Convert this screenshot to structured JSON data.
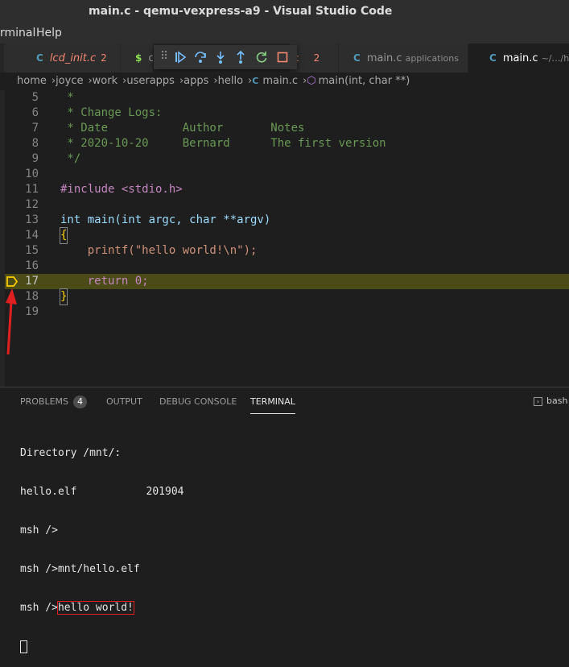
{
  "window": {
    "title": "main.c - qemu-vexpress-a9 - Visual Studio Code"
  },
  "menu": {
    "items": [
      "rminal",
      "Help"
    ]
  },
  "tabs": [
    {
      "icon": "C",
      "label": "lcd_init.c",
      "count": "2",
      "state": "error"
    },
    {
      "icon": "$",
      "label": "c",
      "state": "normal"
    },
    {
      "icon": "",
      "label": "c",
      "count": "2",
      "state": "hidden"
    },
    {
      "icon": "C",
      "label": "main.c",
      "desc": "applications",
      "state": "normal"
    },
    {
      "icon": "C",
      "label": "main.c",
      "desc": "~/…/hel",
      "state": "active"
    }
  ],
  "debug_toolbar": {
    "icons": [
      "continue-icon",
      "step-over-icon",
      "step-into-icon",
      "step-out-icon",
      "restart-icon",
      "stop-icon"
    ]
  },
  "breadcrumb": {
    "items": [
      "home",
      "joyce",
      "work",
      "userapps",
      "apps",
      "hello",
      "main.c",
      "main(int, char **)"
    ]
  },
  "editor": {
    "current_line": "17",
    "lines": [
      {
        "num": "5",
        "text": " *"
      },
      {
        "num": "6",
        "text": " * Change Logs:"
      },
      {
        "num": "7",
        "text": " * Date           Author       Notes"
      },
      {
        "num": "8",
        "text": " * 2020-10-20     Bernard      The first version"
      },
      {
        "num": "9",
        "text": " */"
      },
      {
        "num": "10",
        "text": ""
      },
      {
        "num": "11",
        "text": "#include <stdio.h>"
      },
      {
        "num": "12",
        "text": ""
      },
      {
        "num": "13",
        "text": "int main(int argc, char **argv)"
      },
      {
        "num": "14",
        "text": "{"
      },
      {
        "num": "15",
        "text": "    printf(\"hello world!\\n\");"
      },
      {
        "num": "16",
        "text": ""
      },
      {
        "num": "17",
        "text": "    return 0;"
      },
      {
        "num": "18",
        "text": "}"
      },
      {
        "num": "19",
        "text": ""
      }
    ]
  },
  "panel": {
    "tabs": [
      "PROBLEMS",
      "OUTPUT",
      "DEBUG CONSOLE",
      "TERMINAL"
    ],
    "problems_count": "4",
    "active_tab": "TERMINAL",
    "terminal_name": "bash"
  },
  "terminal": {
    "lines": [
      "Directory /mnt/:",
      "hello.elf           201904",
      "msh />",
      "msh />mnt/hello.elf"
    ],
    "last_prompt": "msh />",
    "last_output": "hello world!"
  },
  "colors": {
    "annotation_arrow": "#e02020",
    "current_line_highlight": "#4b4b18",
    "breakpoint_arrow": "#ffcc00"
  }
}
